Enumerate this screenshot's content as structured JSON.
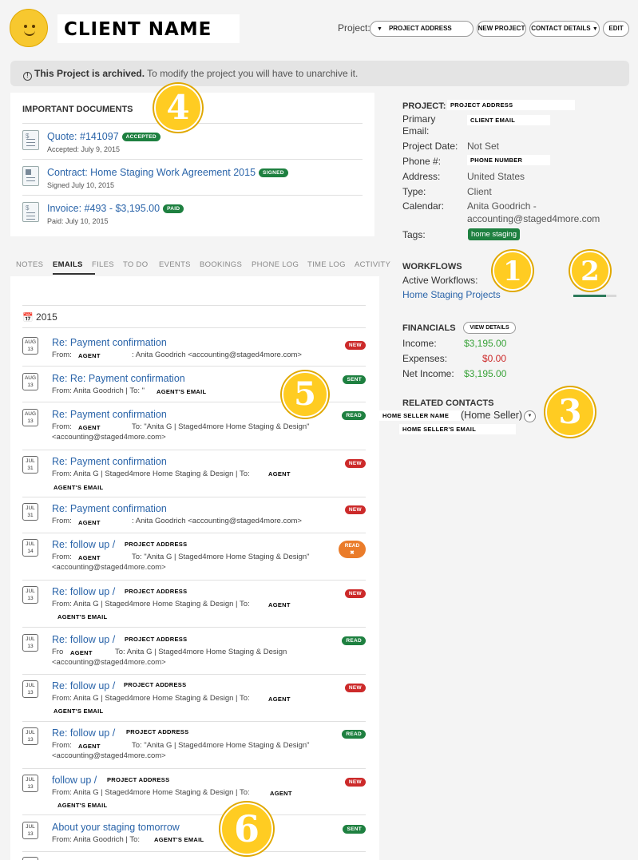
{
  "header": {
    "client_name": "CLIENT NAME",
    "project_label": "Project:",
    "project_select": "PROJECT ADDRESS",
    "buttons": {
      "new_project": "NEW PROJECT",
      "contact_details": "CONTACT DETAILS",
      "edit": "EDIT"
    }
  },
  "archived": {
    "bold": "This Project is archived.",
    "text": " To modify the project you will have to unarchive it."
  },
  "documents": {
    "heading": "IMPORTANT DOCUMENTS",
    "items": [
      {
        "title": "Quote: #141097",
        "badge": "ACCEPTED",
        "sub": "Accepted: July 9, 2015"
      },
      {
        "title": "Contract: Home Staging Work Agreement 2015",
        "badge": "SIGNED",
        "sub": "Signed July 10, 2015"
      },
      {
        "title": "Invoice: #493 - $3,195.00",
        "badge": "PAID",
        "sub": "Paid: July 10, 2015"
      }
    ]
  },
  "tabs": [
    "NOTES",
    "EMAILS",
    "FILES",
    "TO DO",
    "EVENTS",
    "BOOKINGS",
    "PHONE LOG",
    "TIME LOG",
    "ACTIVITY"
  ],
  "emails": {
    "year": "2015",
    "items": [
      {
        "month": "AUG",
        "day": "13",
        "subject": "Re: Payment confirmation",
        "status": "NEW",
        "from1": "From:",
        "box1": "AGENT",
        "from2": ": Anita Goodrich <accounting@staged4more.com>",
        "from3": ""
      },
      {
        "month": "AUG",
        "day": "13",
        "subject": "Re: Re: Payment confirmation",
        "status": "SENT",
        "from1": "From: Anita Goodrich | To: \"",
        "box1": "AGENT'S EMAIL",
        "from2": "",
        "from3": ""
      },
      {
        "month": "AUG",
        "day": "13",
        "subject": "Re: Payment confirmation",
        "status": "READ",
        "from1": "From:",
        "box1": "AGENT",
        "from2": "To: \"Anita G | Staged4more Home Staging & Design\"",
        "from3": "<accounting@staged4more.com>"
      },
      {
        "month": "JUL",
        "day": "31",
        "subject": "Re: Payment confirmation",
        "status": "NEW",
        "from1": "From: Anita G | Staged4more Home Staging & Design | To:",
        "box1": "AGENT",
        "from2": "",
        "box2": "AGENT'S EMAIL"
      },
      {
        "month": "JUL",
        "day": "31",
        "subject": "Re: Payment confirmation",
        "status": "NEW",
        "from1": "From:",
        "box1": "AGENT",
        "from2": ": Anita Goodrich <accounting@staged4more.com>",
        "from3": ""
      },
      {
        "month": "JUL",
        "day": "14",
        "subject": "Re: follow up /",
        "subject_box": "PROJECT ADDRESS",
        "status": "READ",
        "status_x": "✖",
        "from1": "From:",
        "box1": "AGENT",
        "from2": "To: \"Anita G | Staged4more Home Staging & Design\"",
        "from3": "<accounting@staged4more.com>"
      },
      {
        "month": "JUL",
        "day": "13",
        "subject": "Re: follow up /",
        "subject_box": "PROJECT ADDRESS",
        "status": "NEW",
        "from1": "From: Anita G | Staged4more Home Staging & Design | To:",
        "box1": "AGENT",
        "box2": "AGENT'S EMAIL"
      },
      {
        "month": "JUL",
        "day": "13",
        "subject": "Re: follow up /",
        "subject_box": "PROJECT ADDRESS",
        "status": "READ",
        "from1": "Fro",
        "box1": "AGENT",
        "from2": "To: Anita G | Staged4more Home Staging & Design",
        "from3": "<accounting@staged4more.com>"
      },
      {
        "month": "JUL",
        "day": "13",
        "subject": "Re: follow up /",
        "subject_box": "PROJECT ADDRESS",
        "status": "NEW",
        "from1": "From: Anita G | Staged4more Home Staging & Design | To:",
        "box1": "AGENT",
        "box2": "AGENT'S EMAIL"
      },
      {
        "month": "JUL",
        "day": "13",
        "subject": "Re: follow up /",
        "subject_box": "PROJECT ADDRESS",
        "status": "READ",
        "from1": "From:",
        "box1": "AGENT",
        "from2": "To: \"Anita G | Staged4more Home Staging & Design\"",
        "from3": "<accounting@staged4more.com>"
      },
      {
        "month": "JUL",
        "day": "13",
        "subject": "follow up /",
        "subject_box": "PROJECT ADDRESS",
        "status": "NEW",
        "from1": "From: Anita G | Staged4more Home Staging & Design | To:",
        "box1": "AGENT",
        "box2": "AGENT'S EMAIL"
      },
      {
        "month": "JUL",
        "day": "13",
        "subject": "About your staging tomorrow",
        "status": "SENT",
        "from1": "From: Anita Goodrich | To:",
        "box1": "AGENT'S EMAIL"
      }
    ]
  },
  "project": {
    "project_label": "PROJECT:",
    "project_value": "PROJECT ADDRESS",
    "primary_label": "Primary",
    "email_label": "Email:",
    "email_value": "CLIENT EMAIL",
    "date_label": "Project Date:",
    "date_value": "Not Set",
    "phone_label": "Phone #:",
    "phone_value": "PHONE NUMBER",
    "address_label": "Address:",
    "address_value": "United States",
    "type_label": "Type:",
    "type_value": "Client",
    "calendar_label": "Calendar:",
    "calendar_value1": "Anita Goodrich -",
    "calendar_value2": "accounting@staged4more.com",
    "tags_label": "Tags:",
    "tag": "home staging"
  },
  "workflows": {
    "heading": "WORKFLOWS",
    "active_label": "Active Workflows:",
    "link": "Home Staging Projects",
    "progress": 0.75
  },
  "financials": {
    "heading": "FINANCIALS",
    "view_details": "VIEW DETAILS",
    "income_label": "Income:",
    "income": "$3,195.00",
    "expenses_label": "Expenses:",
    "expenses": "$0.00",
    "net_label": "Net Income:",
    "net": "$3,195.00"
  },
  "related": {
    "heading": "RELATED CONTACTS",
    "seller_name": "HOME SELLER NAME",
    "role": "(Home Seller)",
    "seller_email": "HOME SELLER'S EMAIL"
  },
  "markers": [
    "1",
    "2",
    "3",
    "4",
    "5",
    "6"
  ],
  "colors": {
    "link": "#2a64a9",
    "green": "#1e8040",
    "red": "#cc2a2a",
    "orange": "#ea7c2a",
    "marker": "#ffcc22",
    "income": "#3aa33a",
    "expense": "#cc2a2a"
  }
}
